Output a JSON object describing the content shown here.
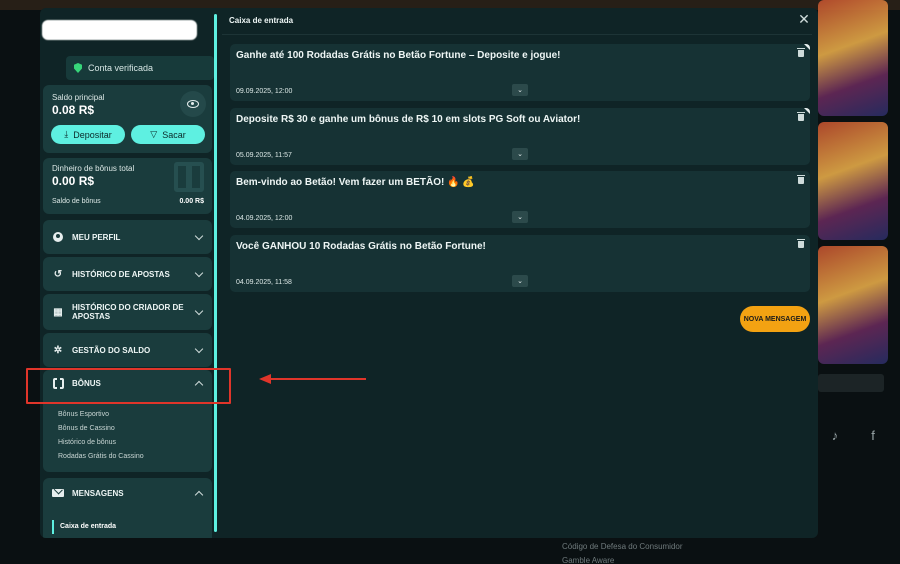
{
  "background": {
    "footer_links": [
      "Código de Defesa do Consumidor",
      "Gamble Aware"
    ],
    "social_icons": [
      "tiktok-icon",
      "facebook-icon"
    ]
  },
  "sidebar": {
    "verified_label": "Conta verificada",
    "main_balance": {
      "label": "Saldo principal",
      "amount": "0.08 R$",
      "deposit_label": "Depositar",
      "withdraw_label": "Sacar"
    },
    "bonus_balance": {
      "label": "Dinheiro de bônus total",
      "amount": "0.00 R$",
      "row_label": "Saldo de bônus",
      "row_value": "0.00 R$"
    },
    "nav": [
      {
        "label": "MEU PERFIL",
        "icon": "user-icon"
      },
      {
        "label": "HISTÓRICO DE APOSTAS",
        "icon": "history-icon"
      },
      {
        "label": "HISTÓRICO DO CRIADOR DE APOSTAS",
        "icon": "bet-builder-icon"
      },
      {
        "label": "GESTÃO DO SALDO",
        "icon": "gear-icon"
      }
    ],
    "bonus_group": {
      "label": "BÔNUS",
      "items": [
        "Bônus Esportivo",
        "Bônus de Cassino",
        "Histórico de bônus",
        "Rodadas Grátis do Cassino"
      ]
    },
    "messages_group": {
      "label": "MENSAGENS",
      "items": [
        "Caixa de entrada"
      ]
    }
  },
  "inbox": {
    "title": "Caixa de entrada",
    "new_message_label": "NOVA MENSAGEM",
    "messages": [
      {
        "title": "Ganhe até 100 Rodadas Grátis no Betão Fortune – Deposite e jogue!",
        "date": "09.09.2025, 12:00",
        "unread": true
      },
      {
        "title": "Deposite R$ 30 e ganhe um bônus de R$ 10 em slots PG Soft ou Aviator!",
        "date": "05.09.2025, 11:57",
        "unread": true
      },
      {
        "title": "Bem-vindo ao Betão! Vem fazer um BETÃO! 🔥 💰",
        "date": "04.09.2025, 12:00",
        "unread": false
      },
      {
        "title": "Você GANHOU 10 Rodadas Grátis no Betão Fortune!",
        "date": "04.09.2025, 11:58",
        "unread": false
      }
    ]
  },
  "colors": {
    "accent": "#5ef0e1",
    "orange": "#f3a212",
    "annotation": "#e0352a",
    "panel": "#1a3c3d"
  }
}
